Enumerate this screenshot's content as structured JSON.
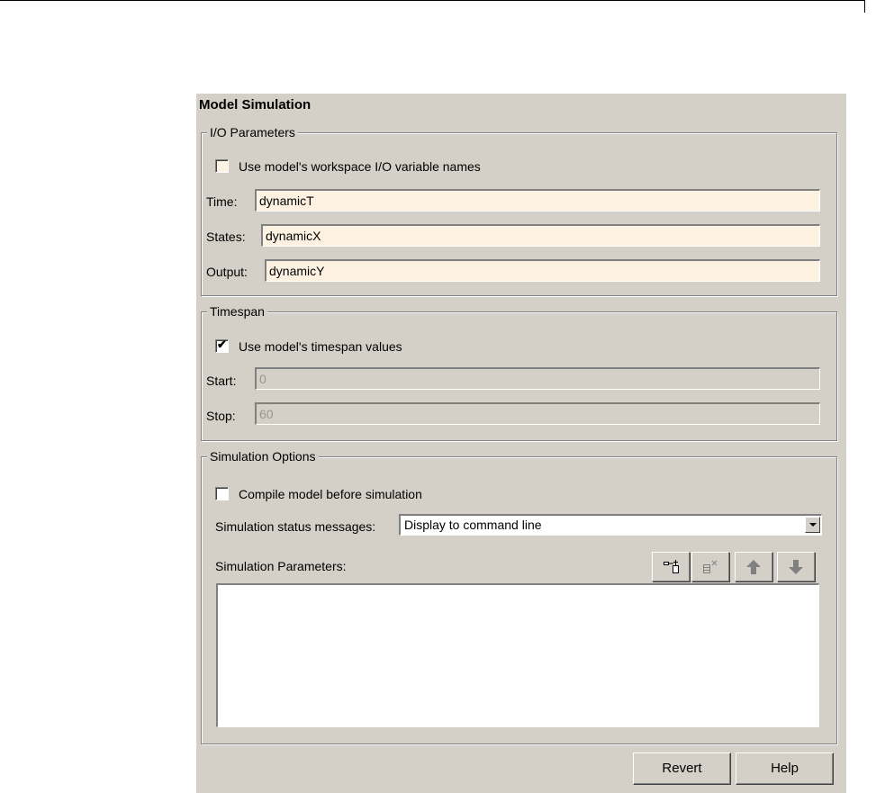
{
  "panel": {
    "title": "Model Simulation"
  },
  "io": {
    "legend": "I/O Parameters",
    "use_names_label": "Use model's workspace I/O variable names",
    "use_names_checked": false,
    "time_label": "Time:",
    "time_value": "dynamicT",
    "states_label": "States:",
    "states_value": "dynamicX",
    "output_label": "Output:",
    "output_value": "dynamicY"
  },
  "timespan": {
    "legend": "Timespan",
    "use_timespan_label": "Use model's timespan values",
    "use_timespan_checked": true,
    "start_label": "Start:",
    "start_value": "0",
    "stop_label": "Stop:",
    "stop_value": "60"
  },
  "sim": {
    "legend": "Simulation Options",
    "compile_label": "Compile model before simulation",
    "compile_checked": false,
    "status_label": "Simulation status messages:",
    "status_value": "Display to command line",
    "params_label": "Simulation Parameters:",
    "toolbar_icons": [
      "add-parameter-icon",
      "remove-parameter-icon",
      "move-up-icon",
      "move-down-icon"
    ]
  },
  "footer": {
    "revert_label": "Revert",
    "help_label": "Help"
  },
  "colors": {
    "panel_bg": "#d4d0c8",
    "field_bg": "#fdf2e2"
  }
}
